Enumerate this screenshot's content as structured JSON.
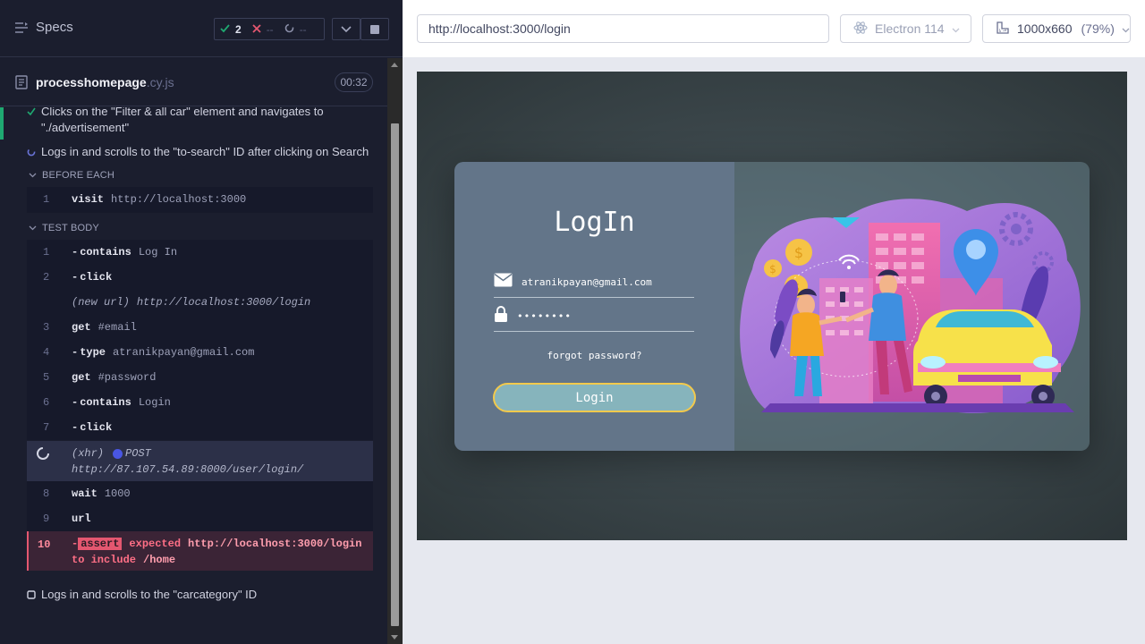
{
  "reporter": {
    "specs_label": "Specs",
    "stats": {
      "passed": "2",
      "failed": "--",
      "pending": "--"
    },
    "spec_name": "processhomepage",
    "spec_ext": ".cy.js",
    "duration": "00:32",
    "tests": [
      {
        "title": "Clicks on the \"Filter & all car\" element and navigates to \"./advertisement\"",
        "state": "passed"
      },
      {
        "title": "Logs in and scrolls to the \"to-search\" ID after clicking on Search",
        "state": "running"
      },
      {
        "title": "Logs in and scrolls to the \"carcategory\" ID",
        "state": "pending"
      }
    ],
    "before_each": {
      "label": "BEFORE EACH",
      "commands": [
        {
          "num": "1",
          "name": "visit",
          "arg": "http://localhost:3000"
        }
      ]
    },
    "test_body": {
      "label": "TEST BODY",
      "commands": [
        {
          "num": "1",
          "name": "contains",
          "arg": "Log In",
          "child": true
        },
        {
          "num": "2",
          "name": "click",
          "arg": "",
          "child": true
        },
        {
          "num": "",
          "name": "(new url)",
          "arg": "http://localhost:3000/login",
          "italic": true
        },
        {
          "num": "3",
          "name": "get",
          "arg": "#email"
        },
        {
          "num": "4",
          "name": "type",
          "arg": "atranikpayan@gmail.com",
          "child": true
        },
        {
          "num": "5",
          "name": "get",
          "arg": "#password"
        },
        {
          "num": "6",
          "name": "contains",
          "arg": "Login",
          "child": true
        },
        {
          "num": "7",
          "name": "click",
          "arg": "",
          "child": true
        }
      ],
      "xhr": {
        "label": "(xhr)",
        "method": "POST",
        "url": "http://87.107.54.89:8000/user/login/"
      },
      "commands_after": [
        {
          "num": "8",
          "name": "wait",
          "arg": "1000"
        },
        {
          "num": "9",
          "name": "url",
          "arg": ""
        }
      ],
      "failed": {
        "num": "10",
        "badge": "assert",
        "expected": "expected",
        "url": "http://localhost:3000/login",
        "to_include": "to include",
        "path": "/home"
      }
    }
  },
  "aut": {
    "url": "http://localhost:3000/login",
    "browser": "Electron 114",
    "viewport": "1000x660",
    "scale": "(79%)",
    "login": {
      "title": "LogIn",
      "email_value": "atranikpayan@gmail.com",
      "password_value": "••••••••",
      "forgot": "forgot password?",
      "button": "Login"
    }
  },
  "colors": {
    "passed": "#1fa971",
    "failed": "#e45770",
    "xhr_dot": "#4956e3",
    "login_button_border": "#f2c94c"
  }
}
